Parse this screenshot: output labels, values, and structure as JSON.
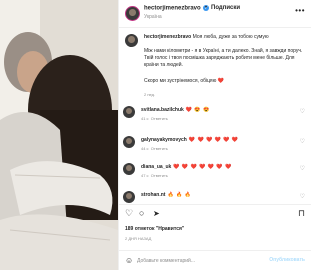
{
  "header": {
    "username": "hectorjimenezbravo",
    "verified_mark": "✓",
    "separator": "•",
    "follow_label": "Подписки",
    "location": "Україна",
    "more_label": "•••"
  },
  "caption": {
    "username": "hectorjimenezbravo",
    "text_line": "Моя люба, дуже за тобою сумую",
    "body": "Між нами кілометри - я в Україні, а ти далеко. Знай, я завжди поруч. Твій голос і твоя посмішка заряджають робити мене більше. Для країни та людей.",
    "closing": "Скоро ми зустрінемося, обіцяю ❤️",
    "time": "2 нед."
  },
  "comments": [
    {
      "username": "svitlana.bazilchuk",
      "text": "❤️ 😍 😍",
      "time": "41 с",
      "reply": "Ответить"
    },
    {
      "username": "galynayakymovych",
      "text": "❤️ ❤️ ❤️ ❤️ ❤️ ❤️",
      "time": "44 с",
      "reply": "Ответить"
    },
    {
      "username": "diana_ua_uk",
      "text": "❤️ ❤️ ❤️ ❤️ ❤️ ❤️ ❤️",
      "time": "47 с",
      "reply": "Ответить"
    },
    {
      "username": "strohan.nt",
      "text": "🔥 🔥 🔥",
      "time": "",
      "reply": ""
    }
  ],
  "actions": {
    "like_icon": "♡",
    "comment_icon": "○",
    "share_icon": "➤",
    "save_icon": "⊓"
  },
  "likes_text": "189 отметок \"Нравится\"",
  "date_text": "2 дня назад",
  "add_comment": {
    "emoji_icon": "☺",
    "placeholder": "Добавьте комментарий...",
    "publish_label": "Опубликовать"
  },
  "colors": {
    "verified": "#3897f0",
    "heart": "#e4405f",
    "publish_disabled": "#b2dffc"
  }
}
